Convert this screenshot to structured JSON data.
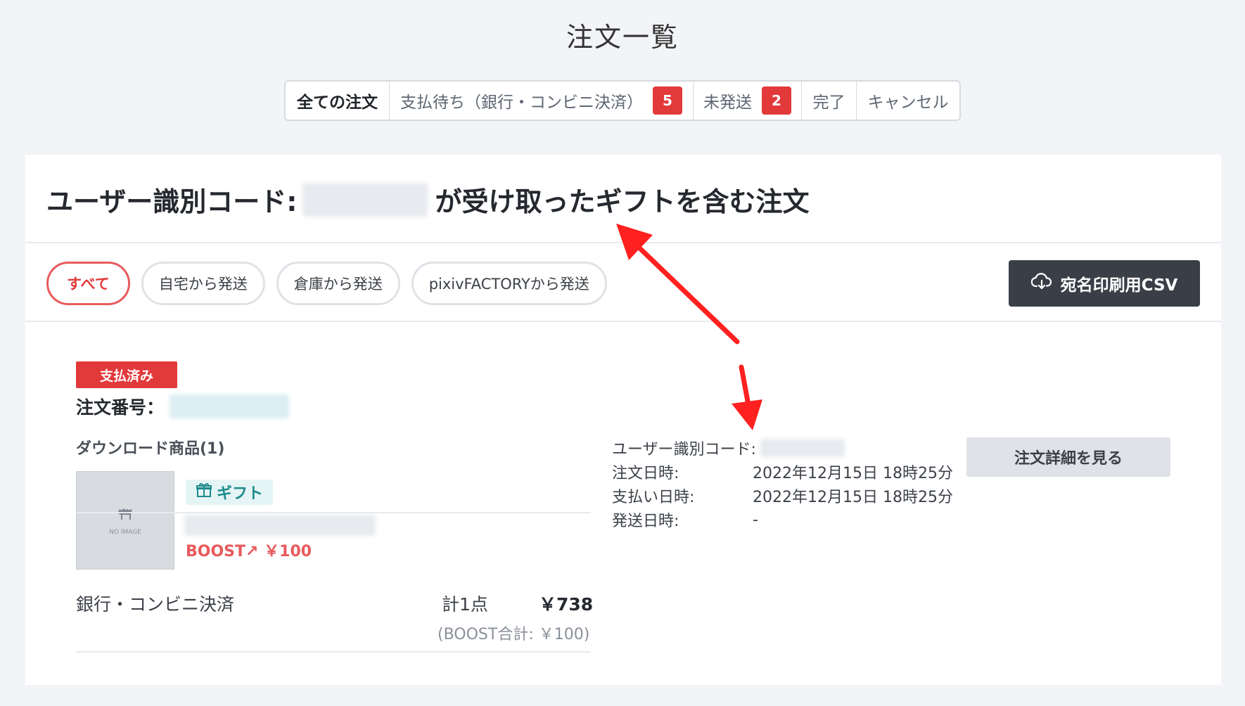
{
  "page": {
    "title": "注文一覧"
  },
  "tabs": [
    {
      "label": "全ての注文",
      "badge": ""
    },
    {
      "label": "支払待ち（銀行・コンビニ決済）",
      "badge": "5"
    },
    {
      "label": "未発送",
      "badge": "2"
    },
    {
      "label": "完了",
      "badge": ""
    },
    {
      "label": "キャンセル",
      "badge": ""
    }
  ],
  "card": {
    "heading_prefix": "ユーザー識別コード:",
    "heading_suffix": "が受け取ったギフトを含む注文",
    "filters": [
      "すべて",
      "自宅から発送",
      "倉庫から発送",
      "pixivFACTORYから発送"
    ],
    "csv_button": "宛名印刷用CSV"
  },
  "order": {
    "status": "支払済み",
    "number_label": "注文番号：",
    "section_label": "ダウンロード商品(1)",
    "thumb_text": "NO IMAGE",
    "gift_label": "ギフト",
    "boost_label": "BOOST↗",
    "boost_price": "￥100",
    "payment_method": "銀行・コンビニ決済",
    "total_count": "計1点",
    "total_price": "￥738",
    "boost_total": "(BOOST合計: ￥100)",
    "info": {
      "user_code_label": "ユーザー識別コード:",
      "order_date_label": "注文日時:",
      "order_date": "2022年12月15日 18時25分",
      "paid_date_label": "支払い日時:",
      "paid_date": "2022年12月15日 18時25分",
      "ship_date_label": "発送日時:",
      "ship_date": "-"
    },
    "detail_button": "注文詳細を見る"
  },
  "colors": {
    "accent": "#e2393b",
    "dark_button": "#3a3f47",
    "gift": "#1c8a8c",
    "annotation_arrow": "#ff2020"
  }
}
